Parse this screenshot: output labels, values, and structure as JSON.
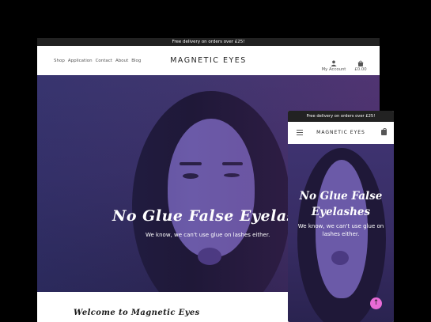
{
  "desktop": {
    "promo": "Free delivery on orders over £25!",
    "nav_links": [
      "Shop",
      "Application",
      "Contact",
      "About",
      "Blog"
    ],
    "logo": "MAGNETIC EYES",
    "account_label": "My Account",
    "cart_total": "£0.00",
    "hero_title": "No Glue False Eyelashes",
    "hero_subtitle": "We know, we can't use glue on lashes either.",
    "welcome_heading": "Welcome to Magnetic Eyes"
  },
  "mobile": {
    "promo": "Free delivery on orders over £25!",
    "logo": "MAGNETIC EYES",
    "hero_title": "No Glue False Eyelashes",
    "hero_subtitle": "We know, we can't use glue on lashes either."
  },
  "colors": {
    "hero_overlay": "#3a2f66",
    "topbar": "#222222",
    "scroll_button": "#e86bd6"
  },
  "icons": {
    "account": "user-icon",
    "cart": "shopping-bag-icon",
    "menu": "hamburger-icon",
    "scroll_up": "arrow-up-icon"
  }
}
